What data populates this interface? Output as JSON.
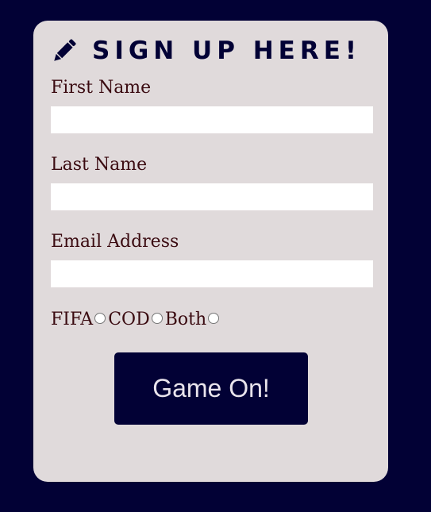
{
  "form": {
    "title": "SIGN UP HERE!",
    "header_icon": "pencil-icon",
    "fields": [
      {
        "label": "First Name",
        "value": "",
        "placeholder": ""
      },
      {
        "label": "Last Name",
        "value": "",
        "placeholder": ""
      },
      {
        "label": "Email Address",
        "value": "",
        "placeholder": ""
      }
    ],
    "radio_options": [
      {
        "label": "FIFA",
        "checked": false
      },
      {
        "label": "COD",
        "checked": false
      },
      {
        "label": "Both",
        "checked": false
      }
    ],
    "submit_label": "Game On!"
  },
  "colors": {
    "background": "#020135",
    "card": "#e0dadb",
    "label_text": "#3a0a10",
    "button": "#020135",
    "button_text": "#e9e4ec"
  }
}
